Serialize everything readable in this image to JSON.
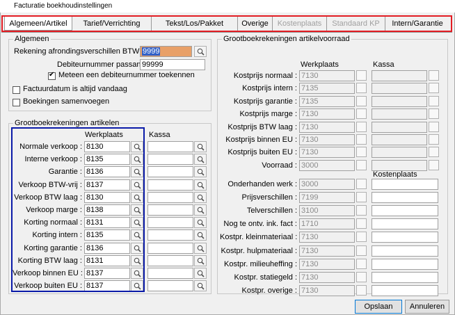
{
  "window": {
    "title": "Facturatie boekhoudinstellingen"
  },
  "tabs": [
    {
      "label": "Algemeen/Artikel",
      "active": true,
      "enabled": true
    },
    {
      "label": "Tarief/Verrichting",
      "enabled": true
    },
    {
      "label": "Tekst/Los/Pakket",
      "enabled": true
    },
    {
      "label": "Overige",
      "enabled": true
    },
    {
      "label": "Kostenplaats",
      "enabled": false
    },
    {
      "label": "Standaard KP",
      "enabled": false
    },
    {
      "label": "Intern/Garantie",
      "enabled": true
    }
  ],
  "algemeen": {
    "legend": "Algemeen",
    "rekening_label": "Rekening afrondingsverschillen BTW :",
    "rekening_value": "9999",
    "debiteur_label": "Debiteurnummer passant :",
    "debiteur_value": "99999",
    "meteen_label": "Meteen een debiteurnummer toekennen",
    "meteen_checked": true,
    "factuurdatum_label": "Factuurdatum is altijd vandaag",
    "factuurdatum_checked": false,
    "boekingen_label": "Boekingen samenvoegen",
    "boekingen_checked": false
  },
  "artikelen": {
    "legend": "Grootboekrekeningen artikelen",
    "col_werkplaats": "Werkplaats",
    "col_kassa": "Kassa",
    "rows": [
      {
        "label": "Normale verkoop :",
        "werkplaats": "8130",
        "kassa": ""
      },
      {
        "label": "Interne verkoop :",
        "werkplaats": "8135",
        "kassa": ""
      },
      {
        "label": "Garantie :",
        "werkplaats": "8136",
        "kassa": ""
      },
      {
        "label": "Verkoop BTW-vrij :",
        "werkplaats": "8137",
        "kassa": ""
      },
      {
        "label": "Verkoop BTW laag :",
        "werkplaats": "8130",
        "kassa": ""
      },
      {
        "label": "Verkoop marge :",
        "werkplaats": "8138",
        "kassa": ""
      },
      {
        "label": "Korting normaal :",
        "werkplaats": "8131",
        "kassa": ""
      },
      {
        "label": "Korting intern :",
        "werkplaats": "8135",
        "kassa": ""
      },
      {
        "label": "Korting garantie :",
        "werkplaats": "8136",
        "kassa": ""
      },
      {
        "label": "Korting BTW laag :",
        "werkplaats": "8131",
        "kassa": ""
      },
      {
        "label": "Verkoop binnen EU :",
        "werkplaats": "8137",
        "kassa": ""
      },
      {
        "label": "Verkoop buiten EU :",
        "werkplaats": "8137",
        "kassa": ""
      }
    ]
  },
  "voorraad": {
    "legend": "Grootboekrekeningen artikelvoorraad",
    "col_werkplaats": "Werkplaats",
    "col_kassa": "Kassa",
    "col_kostenplaats": "Kostenplaats",
    "rows_top": [
      {
        "label": "Kostprijs normaal :",
        "werkplaats": "7130",
        "kassa": ""
      },
      {
        "label": "Kostprijs intern :",
        "werkplaats": "7135",
        "kassa": ""
      },
      {
        "label": "Kostprijs garantie :",
        "werkplaats": "7135",
        "kassa": ""
      },
      {
        "label": "Kostprijs marge :",
        "werkplaats": "7130",
        "kassa": ""
      },
      {
        "label": "Kostprijs BTW laag :",
        "werkplaats": "7130",
        "kassa": ""
      },
      {
        "label": "Kostprijs binnen EU :",
        "werkplaats": "7130",
        "kassa": ""
      },
      {
        "label": "Kostprijs buiten EU :",
        "werkplaats": "7130",
        "kassa": ""
      },
      {
        "label": "Voorraad :",
        "werkplaats": "3000",
        "kassa": ""
      }
    ],
    "rows_bottom": [
      {
        "label": "Onderhanden werk :",
        "werkplaats": "3000",
        "kostenplaats": ""
      },
      {
        "label": "Prijsverschillen :",
        "werkplaats": "7199",
        "kostenplaats": ""
      },
      {
        "label": "Telverschillen :",
        "werkplaats": "3100",
        "kostenplaats": ""
      },
      {
        "label": "Nog te ontv. ink. fact :",
        "werkplaats": "1710",
        "kostenplaats": ""
      },
      {
        "label": "Kostpr. kleinmateriaal :",
        "werkplaats": "7130",
        "kostenplaats": ""
      },
      {
        "label": "Kostpr. hulpmateriaal :",
        "werkplaats": "7130",
        "kostenplaats": ""
      },
      {
        "label": "Kostpr. milieuheffing :",
        "werkplaats": "7130",
        "kostenplaats": ""
      },
      {
        "label": "Kostpr. statiegeld :",
        "werkplaats": "7130",
        "kostenplaats": ""
      },
      {
        "label": "Kostpr. overige :",
        "werkplaats": "7130",
        "kostenplaats": ""
      }
    ]
  },
  "footer": {
    "save_label": "Opslaan",
    "cancel_label": "Annuleren"
  },
  "colors": {
    "highlight_red": "#e31c23",
    "highlight_blue": "#0a1aa8",
    "selection_orange": "#e8a068"
  }
}
